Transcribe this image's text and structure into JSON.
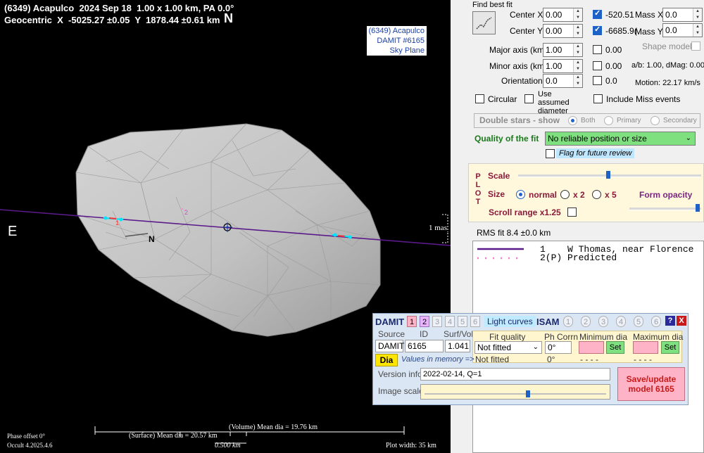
{
  "plot": {
    "title_line1": "(6349) Acapulco  2024 Sep 18  1.00 x 1.00 km, PA 0.0°",
    "title_line2": "Geocentric  X  -5025.27 ±0.05  Y  1878.44 ±0.61 km",
    "north_label": "N",
    "east_label": "E",
    "legend": {
      "line1": "(6349) Acapulco",
      "line2": "DAMIT #6165",
      "line3": "Sky Plane"
    },
    "shape_north_label": "N",
    "chord_label_1": "1",
    "chord_label_2": "2",
    "mas_label": "1 mas",
    "volume_dia": "(Volume) Mean dia = 19.76 km",
    "surface_dia": "(Surface) Mean dia = 20.57 km",
    "scale_label": "0.500 km",
    "phase_offset": "Phase offset 0°",
    "version": "Occult 4.2025.4.6",
    "plot_width": "Plot width: 35 km"
  },
  "panel": {
    "find_best_fit": "Find best fit",
    "center_x_label": "Center X",
    "center_x_value": "0.00",
    "center_x_fit": "-520.51",
    "center_y_label": "Center Y",
    "center_y_value": "0.00",
    "center_y_fit": "-6685.9(",
    "mass_x_label": "Mass X",
    "mass_x_value": "0.0",
    "mass_y_label": "Mass Y",
    "mass_y_value": "0.0",
    "major_label": "Major axis (km)",
    "major_value": "1.00",
    "major_fit": "0.00",
    "minor_label": "Minor axis (km)",
    "minor_value": "1.00",
    "minor_fit": "0.00",
    "orient_label": "Orientation",
    "orient_value": "0.0",
    "orient_fit": "0.0",
    "shape_model": "Shape model",
    "ab_text": "a/b: 1.00, dMag: 0.00",
    "motion_text": "Motion: 22.17 km/s",
    "circular": "Circular",
    "use_assumed": "Use assumed diameter",
    "include_miss": "Include Miss events",
    "double_stars": "Double stars - show",
    "both": "Both",
    "primary": "Primary",
    "secondary": "Secondary",
    "quality_label": "Quality of the fit",
    "quality_value": "No reliable position or size",
    "flag_review": "Flag for future review",
    "plot_vert": [
      "P",
      "L",
      "O",
      "T"
    ],
    "scale_label": "Scale",
    "size_label": "Size",
    "size_normal": "normal",
    "size_x2": "x 2",
    "size_x5": "x 5",
    "form_opacity": "Form opacity",
    "scroll_range": "Scroll range x1.25",
    "rms_fit": "RMS fit 8.4 ±0.0 km",
    "event1": "1    W Thomas, near Florence",
    "event2": "2(P) Predicted"
  },
  "damit": {
    "title": "DAMIT",
    "nums": [
      "1",
      "2",
      "3",
      "4",
      "5",
      "6"
    ],
    "light_curves": "Light curves",
    "isam": "ISAM",
    "isam_nums": [
      "1",
      "2",
      "3",
      "4",
      "5",
      "6"
    ],
    "help": "?",
    "close": "X",
    "source_label": "Source",
    "id_label": "ID",
    "surfvol_label": "Surf/Vol",
    "source_value": "DAMIT",
    "id_value": "6165",
    "surfvol_value": "1.041",
    "fit_quality_label": "Fit quality",
    "ph_corrn_label": "Ph Corrn",
    "min_dia_label": "Minimum dia",
    "max_dia_label": "Maximum dia",
    "fit_quality_value": "Not fitted",
    "ph_corrn_value": "0°",
    "set": "Set",
    "dia_btn": "Dia",
    "values_in_memory": "Values in memory =>",
    "mem_fit": "Not fitted",
    "mem_ph": "0°",
    "mem_min": "- - - -",
    "mem_max": "- - - -",
    "version_label": "Version info",
    "version_value": "2022-02-14, Q=1",
    "image_scale_label": "Image scale",
    "save_line1": "Save/update",
    "save_line2": "model 6165"
  }
}
